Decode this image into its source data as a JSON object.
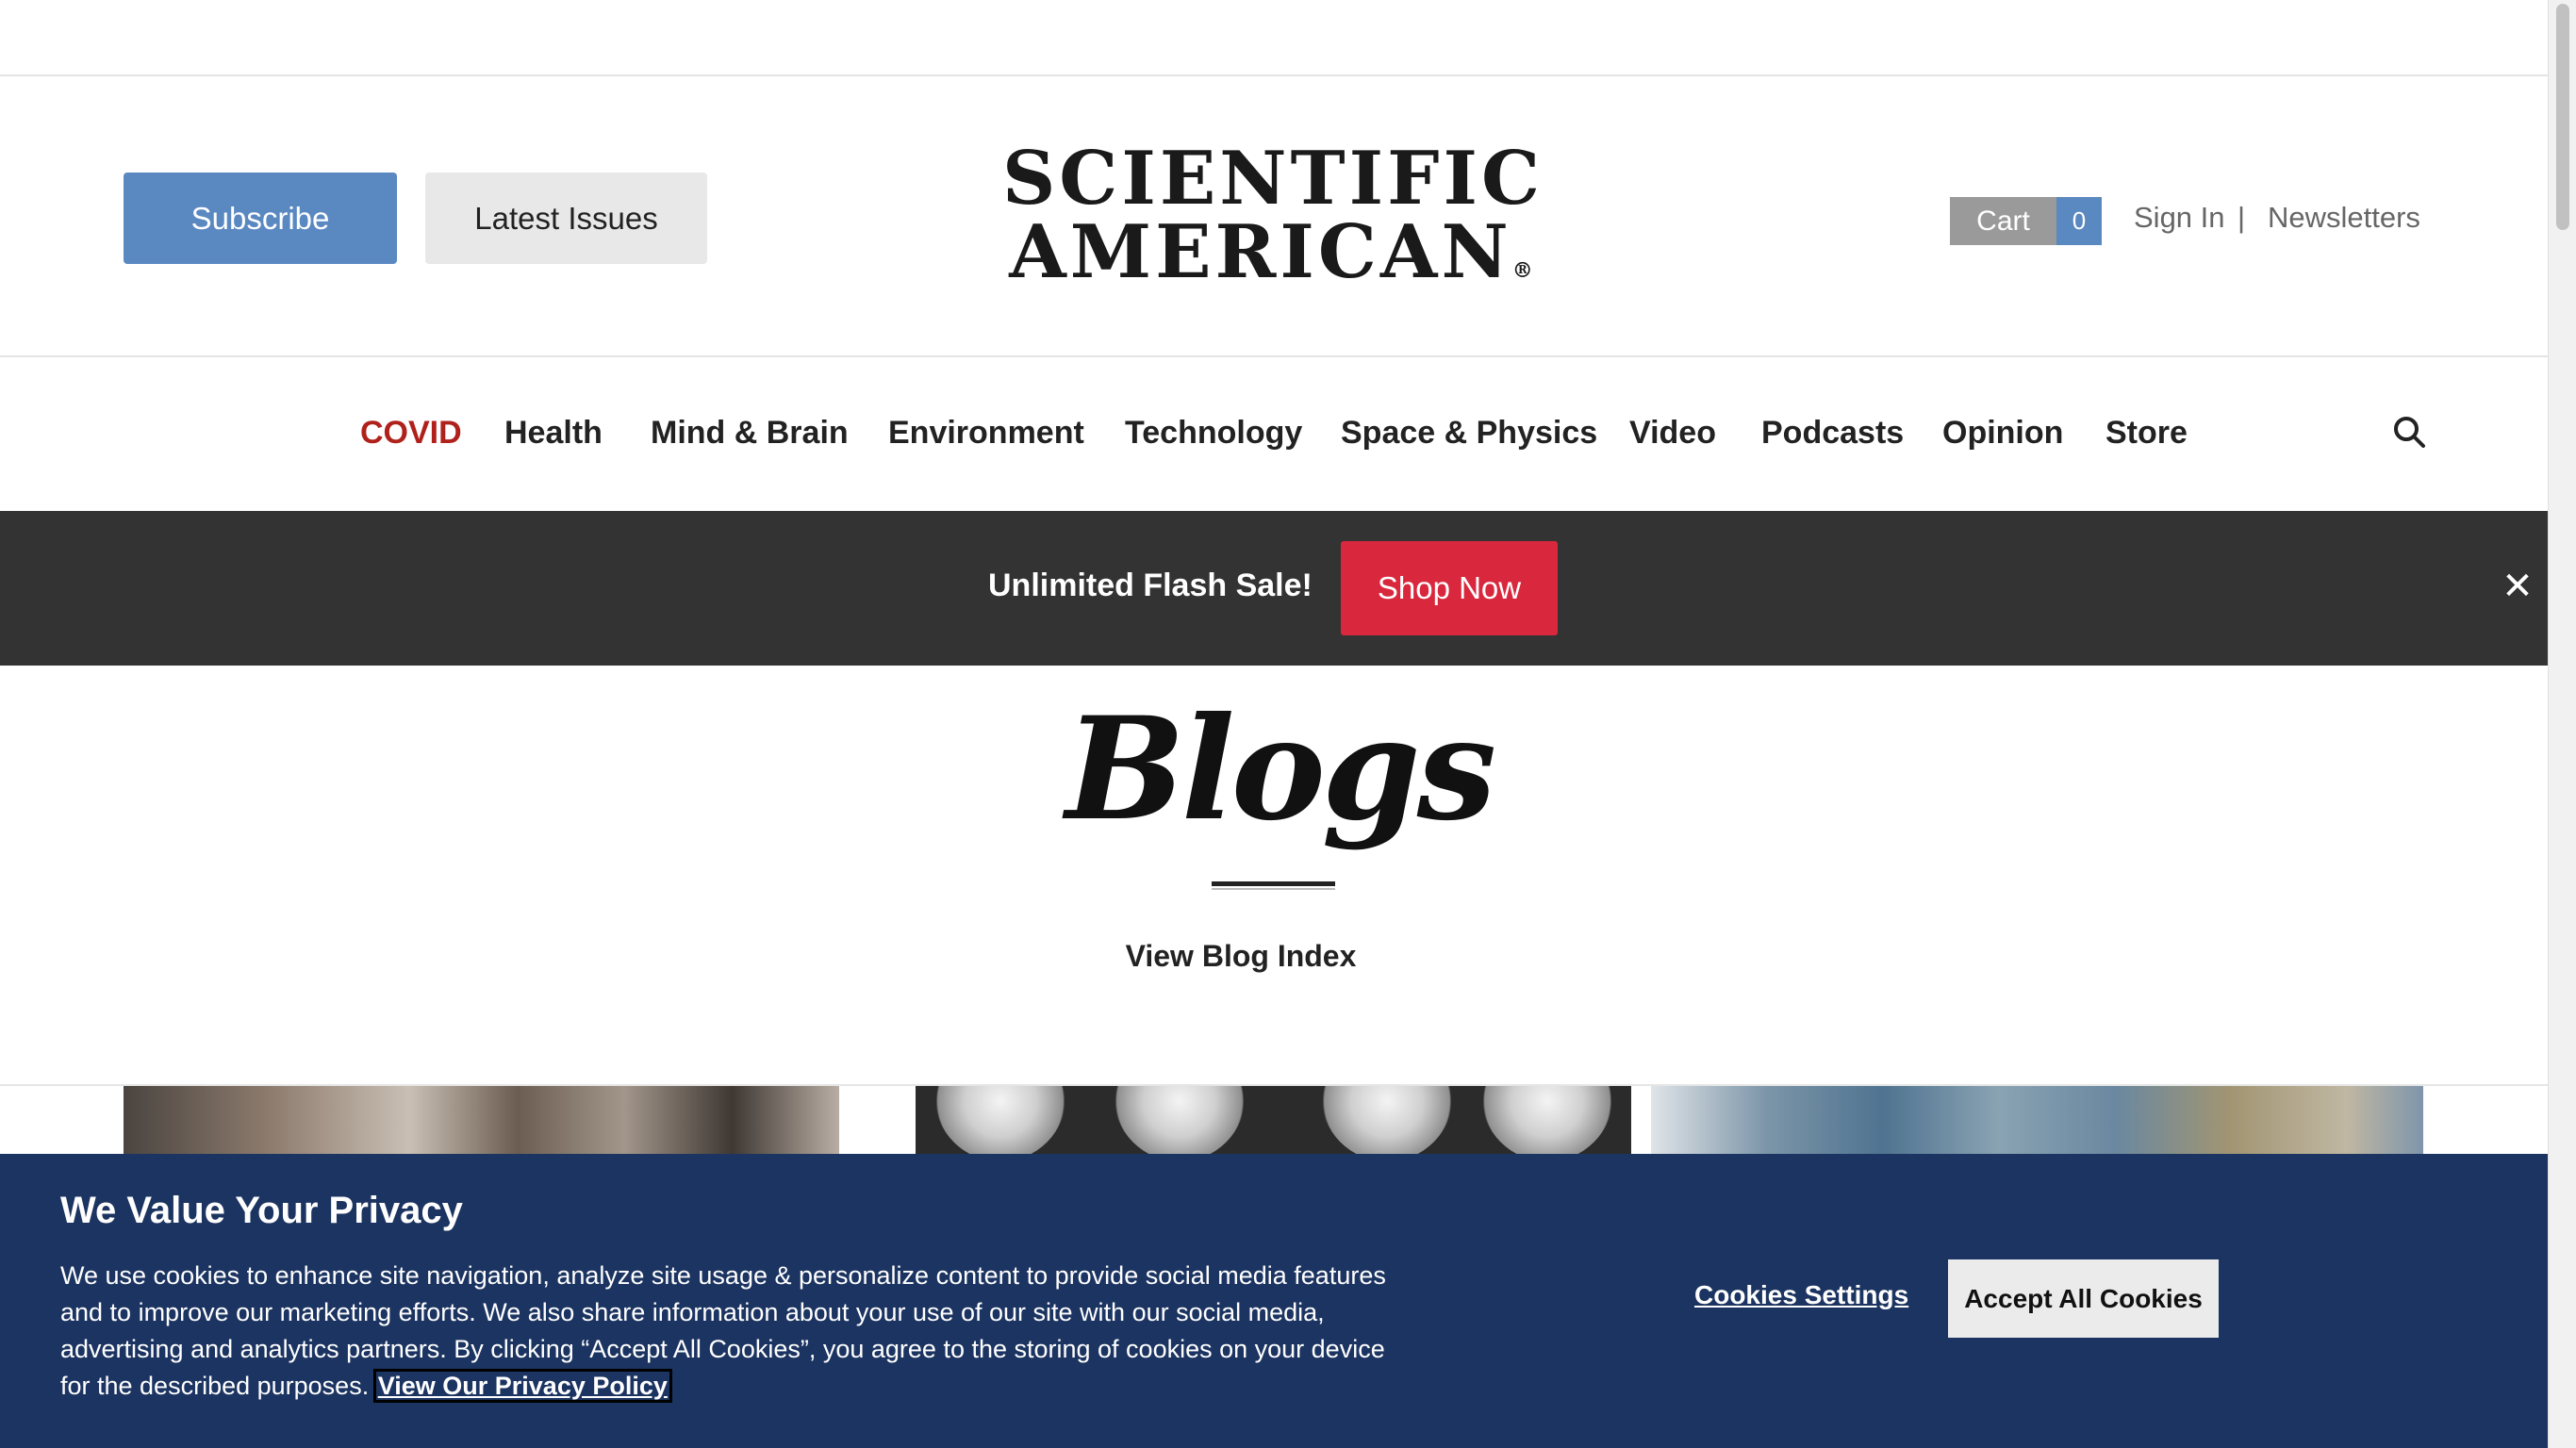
{
  "header": {
    "subscribe_label": "Subscribe",
    "latest_issues_label": "Latest Issues",
    "logo_line1": "SCIENTIFIC",
    "logo_line2": "AMERICAN",
    "logo_mark": "®",
    "cart_label": "Cart",
    "cart_count": "0",
    "sign_in_label": "Sign In",
    "separator": "|",
    "newsletters_label": "Newsletters"
  },
  "nav": {
    "items": [
      {
        "label": "COVID"
      },
      {
        "label": "Health"
      },
      {
        "label": "Mind & Brain"
      },
      {
        "label": "Environment"
      },
      {
        "label": "Technology"
      },
      {
        "label": "Space & Physics"
      },
      {
        "label": "Video"
      },
      {
        "label": "Podcasts"
      },
      {
        "label": "Opinion"
      },
      {
        "label": "Store"
      }
    ],
    "search_icon": "search-icon",
    "highlight_color": "#b0211c"
  },
  "promo": {
    "text": "Unlimited Flash Sale!",
    "button_label": "Shop Now",
    "button_color": "#d9283d",
    "close_glyph": "✕"
  },
  "blogs": {
    "title": "Blogs",
    "index_link": "View Blog Index"
  },
  "cookie_banner": {
    "title": "We Value Your Privacy",
    "body": "We use cookies to enhance site navigation, analyze site usage & personalize content to provide social media features and to improve our marketing efforts. We also share information about your use of our site with our social media, advertising and analytics partners. By clicking “Accept All Cookies”, you agree to the storing of cookies on your device for the described purposes.",
    "policy_link": "View Our Privacy Policy",
    "settings_label": "Cookies Settings",
    "accept_label": "Accept All Cookies",
    "background_color": "#1c3461"
  },
  "colors": {
    "subscribe": "#5a88c1",
    "promo_bar": "#333333"
  }
}
